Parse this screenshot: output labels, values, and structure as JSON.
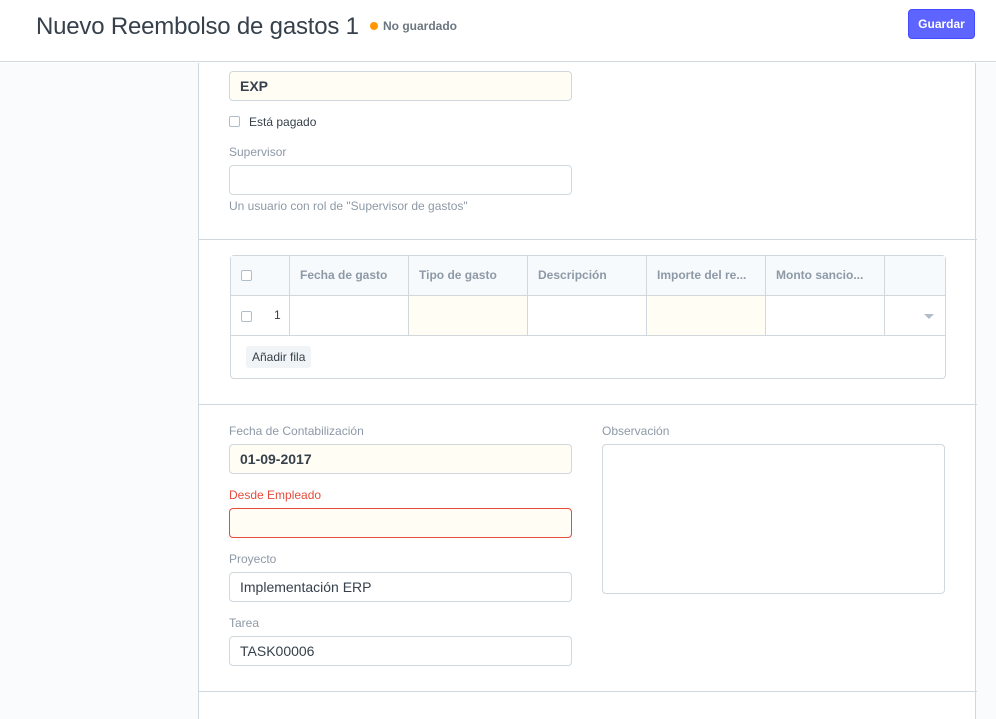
{
  "header": {
    "title": "Nuevo Reembolso de gastos 1",
    "status": "No guardado",
    "save_label": "Guardar"
  },
  "section1": {
    "naming_series_value": "EXP",
    "is_paid_label": "Está pagado",
    "supervisor_label": "Supervisor",
    "supervisor_value": "",
    "supervisor_help": "Un usuario con rol de \"Supervisor de gastos\""
  },
  "expenses_table": {
    "columns": [
      "Fecha de gasto",
      "Tipo de gasto",
      "Descripción",
      "Importe del re...",
      "Monto sancio..."
    ],
    "rows": [
      {
        "idx": "1",
        "fecha": "",
        "tipo": "",
        "descripcion": "",
        "importe": "",
        "monto": ""
      }
    ],
    "add_row_label": "Añadir fila"
  },
  "section3": {
    "posting_date_label": "Fecha de Contabilización",
    "posting_date_value": "01-09-2017",
    "employee_label": "Desde Empleado",
    "employee_value": "",
    "project_label": "Proyecto",
    "project_value": "Implementación ERP",
    "task_label": "Tarea",
    "task_value": "TASK00006",
    "remark_label": "Observación",
    "remark_value": ""
  },
  "colors": {
    "primary": "#5e64ff",
    "unsaved_indicator": "#ff9800",
    "error": "#e74c3c",
    "mandatory_bg": "#fffdf4"
  }
}
